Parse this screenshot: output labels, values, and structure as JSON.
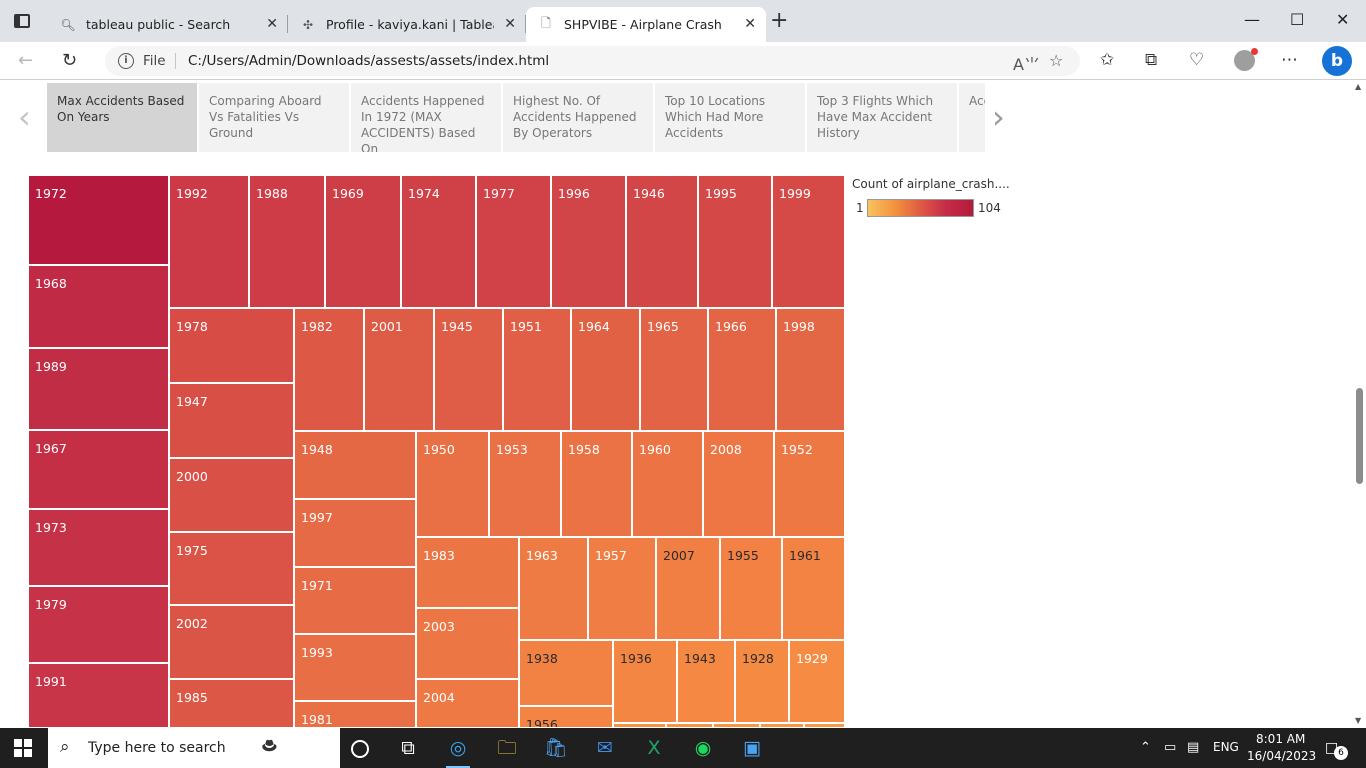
{
  "browser": {
    "tabs": [
      {
        "title": "tableau public - Search",
        "icon": "search-icon",
        "active": false
      },
      {
        "title": "Profile - kaviya.kani | Tableau Pub",
        "icon": "tableau-icon",
        "active": false
      },
      {
        "title": "SHPVIBE - Airplane Crash",
        "icon": "page-icon",
        "active": true
      }
    ],
    "address": {
      "scheme_label": "File",
      "url": "C:/Users/Admin/Downloads/assests/assets/index.html"
    }
  },
  "story": {
    "points": [
      "Max Accidents Based On Years",
      "Comparing Aboard Vs Fatalities Vs Ground",
      "Accidents Happened In 1972 (MAX ACCIDENTS) Based On",
      "Highest No. Of Accidents Happened By Operators",
      "Top 10 Locations Which Had More Accidents",
      "Top 3 Flights Which Have Max Accident History",
      "Accidents Regarding"
    ],
    "selected_index": 0
  },
  "legend": {
    "title": "Count of airplane_crash....",
    "min": "1",
    "max": "104",
    "colors": [
      "#f7c35e",
      "#f5933f",
      "#e05a46",
      "#c42c46",
      "#b51a3e"
    ]
  },
  "chart_data": {
    "type": "treemap",
    "measure": "Count of airplane_crash....",
    "range": [
      1,
      104
    ],
    "years": [
      "1972",
      "1968",
      "1989",
      "1967",
      "1973",
      "1979",
      "1991",
      "1992",
      "1988",
      "1969",
      "1974",
      "1977",
      "1996",
      "1946",
      "1995",
      "1999",
      "1978",
      "1947",
      "2000",
      "1975",
      "2002",
      "1985",
      "1982",
      "2001",
      "1945",
      "1951",
      "1964",
      "1965",
      "1966",
      "1998",
      "1948",
      "1997",
      "1971",
      "1993",
      "1981",
      "1950",
      "1953",
      "1958",
      "1960",
      "2008",
      "1952",
      "1983",
      "2003",
      "2004",
      "1963",
      "1957",
      "2007",
      "1955",
      "1961",
      "1938",
      "1956",
      "1936",
      "1943",
      "1928",
      "1929"
    ]
  },
  "taskbar": {
    "search_placeholder": "Type here to search",
    "language": "ENG",
    "time": "8:01 AM",
    "date": "16/04/2023",
    "notifications": "6"
  }
}
